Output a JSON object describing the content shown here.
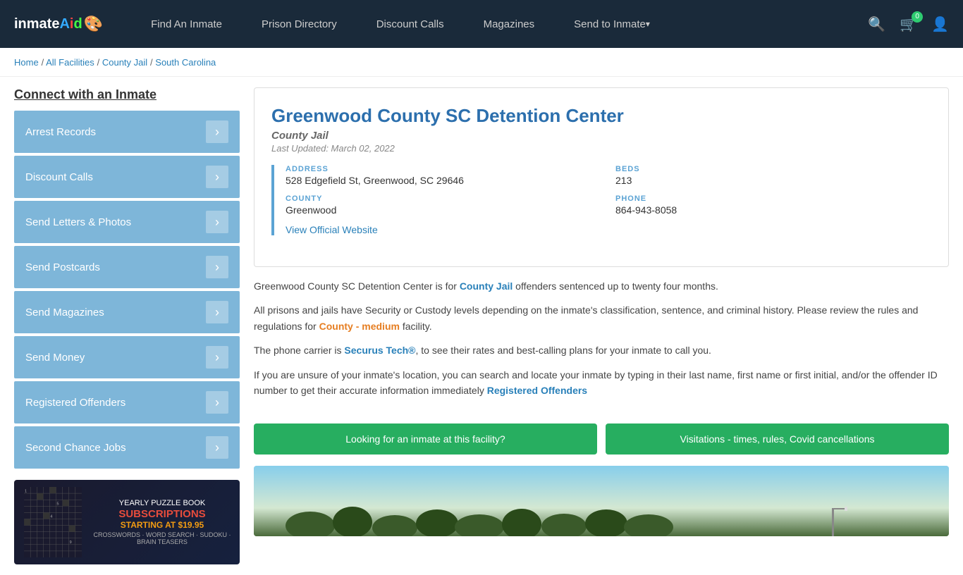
{
  "header": {
    "logo": "inmateAid",
    "nav": [
      {
        "label": "Find An Inmate",
        "id": "find-inmate"
      },
      {
        "label": "Prison Directory",
        "id": "prison-directory"
      },
      {
        "label": "Discount Calls",
        "id": "discount-calls"
      },
      {
        "label": "Magazines",
        "id": "magazines"
      },
      {
        "label": "Send to Inmate",
        "id": "send-to-inmate",
        "dropdown": true
      }
    ],
    "cart_count": "0",
    "icons": {
      "search": "🔍",
      "cart": "🛒",
      "user": "👤"
    }
  },
  "breadcrumb": {
    "items": [
      "Home",
      "All Facilities",
      "County Jail",
      "South Carolina"
    ],
    "links": [
      true,
      true,
      true,
      true
    ]
  },
  "sidebar": {
    "title": "Connect with an Inmate",
    "menu_items": [
      "Arrest Records",
      "Discount Calls",
      "Send Letters & Photos",
      "Send Postcards",
      "Send Magazines",
      "Send Money",
      "Registered Offenders",
      "Second Chance Jobs"
    ]
  },
  "ad": {
    "line1": "YEARLY PUZZLE BOOK",
    "line2": "SUBSCRIPTIONS",
    "price": "STARTING AT $19.95",
    "games": "CROSSWORDS · WORD SEARCH · SUDOKU · BRAIN TEASERS"
  },
  "facility": {
    "title": "Greenwood County SC Detention Center",
    "type": "County Jail",
    "last_updated": "Last Updated: March 02, 2022",
    "address_label": "ADDRESS",
    "address_value": "528 Edgefield St, Greenwood, SC 29646",
    "beds_label": "BEDS",
    "beds_value": "213",
    "county_label": "COUNTY",
    "county_value": "Greenwood",
    "phone_label": "PHONE",
    "phone_value": "864-943-8058",
    "website_link": "View Official Website",
    "description1": "Greenwood County SC Detention Center is for ",
    "description1_link": "County Jail",
    "description1_rest": " offenders sentenced up to twenty four months.",
    "description2": "All prisons and jails have Security or Custody levels depending on the inmate's classification, sentence, and criminal history. Please review the rules and regulations for ",
    "description2_link": "County - medium",
    "description2_rest": " facility.",
    "description3": "The phone carrier is ",
    "description3_link": "Securus Tech®",
    "description3_rest": ", to see their rates and best-calling plans for your inmate to call you.",
    "description4": "If you are unsure of your inmate's location, you can search and locate your inmate by typing in their last name, first name or first initial, and/or the offender ID number to get their accurate information immediately ",
    "description4_link": "Registered Offenders",
    "btn1": "Looking for an inmate at this facility?",
    "btn2": "Visitations - times, rules, Covid cancellations"
  }
}
